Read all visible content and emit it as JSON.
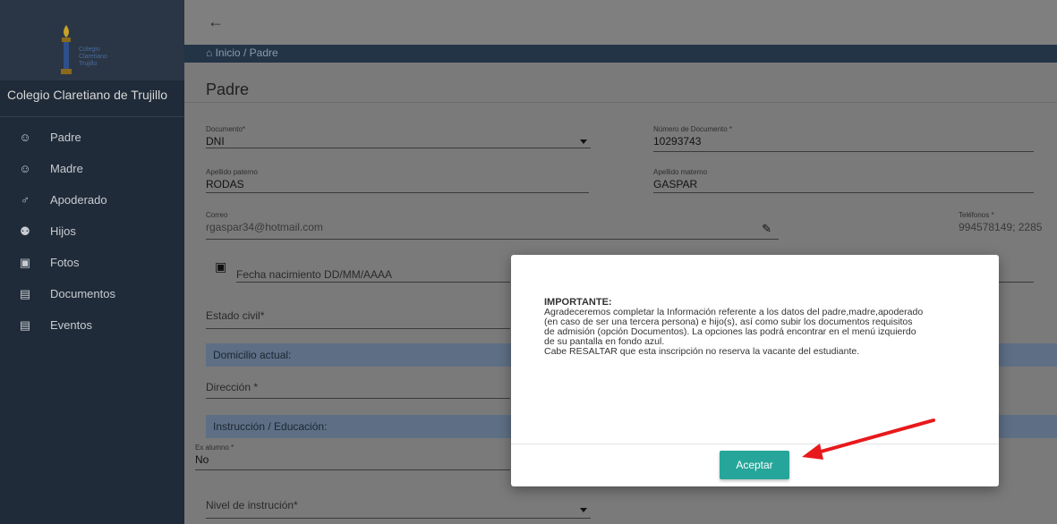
{
  "school": {
    "logo_text": "Colegio Claretiano Trujillo",
    "name": "Colegio Claretiano de Trujillo"
  },
  "sidebar": {
    "items": [
      {
        "label": "Padre",
        "icon": "user-icon"
      },
      {
        "label": "Madre",
        "icon": "user-female-icon"
      },
      {
        "label": "Apoderado",
        "icon": "user-tie-icon"
      },
      {
        "label": "Hijos",
        "icon": "children-icon"
      },
      {
        "label": "Fotos",
        "icon": "photo-icon"
      },
      {
        "label": "Documentos",
        "icon": "document-icon"
      },
      {
        "label": "Eventos",
        "icon": "event-icon"
      }
    ]
  },
  "topbar": {
    "back_icon": "back-arrow-icon"
  },
  "breadcrumb": {
    "home": "Inicio",
    "separator": "/",
    "current": "Padre"
  },
  "page": {
    "title": "Padre",
    "fields": {
      "documento": {
        "label": "Documento*",
        "value": "DNI"
      },
      "numero_documento": {
        "label": "Número de Documento *",
        "value": "10293743"
      },
      "apellido_paterno": {
        "label": "Apellido paterno",
        "value": "RODAS"
      },
      "apellido_materno": {
        "label": "Apellido materno",
        "value": "GASPAR"
      },
      "correo": {
        "label": "Correo",
        "value": "rgaspar34@hotmail.com"
      },
      "telefonos": {
        "label": "Teléfonos *",
        "value": "994578149; 2285"
      },
      "fecha_nacimiento": {
        "placeholder": "Fecha nacimiento DD/MM/AAAA"
      },
      "estado_civil": {
        "placeholder": "Estado civil*"
      },
      "direccion": {
        "placeholder": "Dirección *"
      },
      "ex_alumno": {
        "label": "Ex alumno *",
        "value": "No"
      },
      "nivel_instruccion": {
        "placeholder": "Nivel de instrución*"
      }
    },
    "sections": {
      "domicilio": "Domicilio actual:",
      "instruccion": "Instrucción / Educación:"
    }
  },
  "modal": {
    "heading": "IMPORTANTE:",
    "lines": [
      "Agradeceremos completar la Información referente a los datos del padre,madre,apoderado",
      "(en caso de ser una tercera persona) e hijo(s), así como subir los documentos requisitos",
      "de admisión (opción Documentos). La opciones las podrá encontrar en el menú izquierdo",
      "de su pantalla en fondo azul.",
      "Cabe RESALTAR que esta inscripción no reserva la vacante del estudiante."
    ],
    "accept_label": "Aceptar"
  },
  "colors": {
    "sidebar_bg": "#1f2b38",
    "accent": "#26a69a",
    "annotation_arrow": "#e8191c"
  }
}
